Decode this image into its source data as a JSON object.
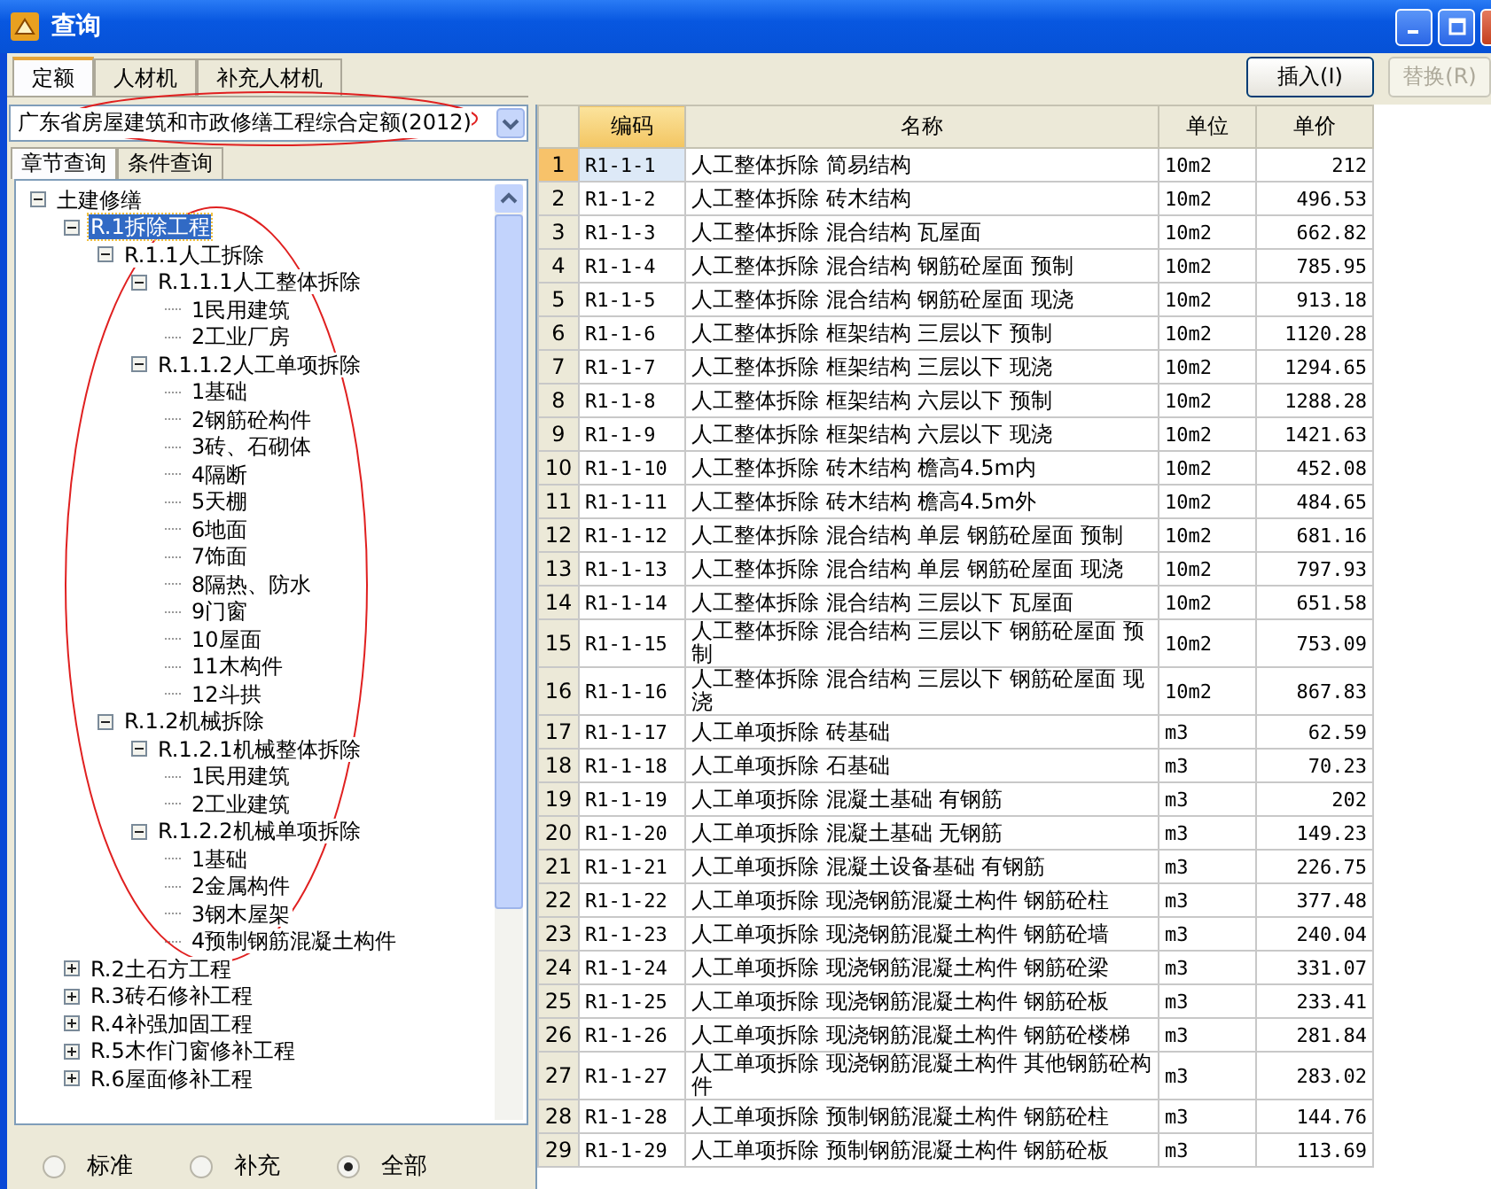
{
  "window": {
    "title": "查询"
  },
  "tabs": [
    {
      "label": "定额",
      "selected": true
    },
    {
      "label": "人材机",
      "selected": false
    },
    {
      "label": "补充人材机",
      "selected": false
    }
  ],
  "buttons": [
    {
      "label": "插入(I)",
      "disabled": false
    },
    {
      "label": "替换(R)",
      "disabled": true
    }
  ],
  "library": {
    "value": "广东省房屋建筑和市政修缮工程综合定额(2012)"
  },
  "query_tabs": [
    {
      "label": "章节查询",
      "selected": true
    },
    {
      "label": "条件查询",
      "selected": false
    }
  ],
  "tree": [
    {
      "label": "土建修缮",
      "expanded": true,
      "selected": false,
      "children": [
        {
          "label": "R.1拆除工程",
          "expanded": true,
          "selected": true,
          "children": [
            {
              "label": "R.1.1人工拆除",
              "expanded": true,
              "selected": false,
              "children": [
                {
                  "label": "R.1.1.1人工整体拆除",
                  "expanded": true,
                  "selected": false,
                  "children": [
                    {
                      "label": "1民用建筑",
                      "selected": false
                    },
                    {
                      "label": "2工业厂房",
                      "selected": false
                    }
                  ]
                },
                {
                  "label": "R.1.1.2人工单项拆除",
                  "expanded": true,
                  "selected": false,
                  "children": [
                    {
                      "label": "1基础",
                      "selected": false
                    },
                    {
                      "label": "2钢筋砼构件",
                      "selected": false
                    },
                    {
                      "label": "3砖、石砌体",
                      "selected": false
                    },
                    {
                      "label": "4隔断",
                      "selected": false
                    },
                    {
                      "label": "5天棚",
                      "selected": false
                    },
                    {
                      "label": "6地面",
                      "selected": false
                    },
                    {
                      "label": "7饰面",
                      "selected": false
                    },
                    {
                      "label": "8隔热、防水",
                      "selected": false
                    },
                    {
                      "label": "9门窗",
                      "selected": false
                    },
                    {
                      "label": "10屋面",
                      "selected": false
                    },
                    {
                      "label": "11木构件",
                      "selected": false
                    },
                    {
                      "label": "12斗拱",
                      "selected": false
                    }
                  ]
                }
              ]
            },
            {
              "label": "R.1.2机械拆除",
              "expanded": true,
              "selected": false,
              "children": [
                {
                  "label": "R.1.2.1机械整体拆除",
                  "expanded": true,
                  "selected": false,
                  "children": [
                    {
                      "label": "1民用建筑",
                      "selected": false
                    },
                    {
                      "label": "2工业建筑",
                      "selected": false
                    }
                  ]
                },
                {
                  "label": "R.1.2.2机械单项拆除",
                  "expanded": true,
                  "selected": false,
                  "children": [
                    {
                      "label": "1基础",
                      "selected": false
                    },
                    {
                      "label": "2金属构件",
                      "selected": false
                    },
                    {
                      "label": "3钢木屋架",
                      "selected": false
                    },
                    {
                      "label": "4预制钢筋混凝土构件",
                      "selected": false
                    }
                  ]
                }
              ]
            }
          ]
        },
        {
          "label": "R.2土石方工程",
          "expanded": false,
          "selected": false
        },
        {
          "label": "R.3砖石修补工程",
          "expanded": false,
          "selected": false
        },
        {
          "label": "R.4补强加固工程",
          "expanded": false,
          "selected": false
        },
        {
          "label": "R.5木作门窗修补工程",
          "expanded": false,
          "selected": false
        },
        {
          "label": "R.6屋面修补工程",
          "expanded": false,
          "selected": false
        }
      ]
    }
  ],
  "filter": [
    {
      "label": "标准",
      "selected": false
    },
    {
      "label": "补充",
      "selected": false
    },
    {
      "label": "全部",
      "selected": true
    }
  ],
  "table": {
    "columns": [
      "编码",
      "名称",
      "单位",
      "单价"
    ],
    "rows": [
      {
        "index": "1",
        "code": "R1-1-1",
        "name": "人工整体拆除 简易结构",
        "unit": "10m2",
        "price": "212",
        "selected": true
      },
      {
        "index": "2",
        "code": "R1-1-2",
        "name": "人工整体拆除 砖木结构",
        "unit": "10m2",
        "price": "496.53",
        "selected": false
      },
      {
        "index": "3",
        "code": "R1-1-3",
        "name": "人工整体拆除 混合结构 瓦屋面",
        "unit": "10m2",
        "price": "662.82",
        "selected": false
      },
      {
        "index": "4",
        "code": "R1-1-4",
        "name": "人工整体拆除 混合结构 钢筋砼屋面 预制",
        "unit": "10m2",
        "price": "785.95",
        "selected": false
      },
      {
        "index": "5",
        "code": "R1-1-5",
        "name": "人工整体拆除 混合结构 钢筋砼屋面 现浇",
        "unit": "10m2",
        "price": "913.18",
        "selected": false
      },
      {
        "index": "6",
        "code": "R1-1-6",
        "name": "人工整体拆除 框架结构 三层以下 预制",
        "unit": "10m2",
        "price": "1120.28",
        "selected": false
      },
      {
        "index": "7",
        "code": "R1-1-7",
        "name": "人工整体拆除 框架结构 三层以下 现浇",
        "unit": "10m2",
        "price": "1294.65",
        "selected": false
      },
      {
        "index": "8",
        "code": "R1-1-8",
        "name": "人工整体拆除 框架结构 六层以下 预制",
        "unit": "10m2",
        "price": "1288.28",
        "selected": false
      },
      {
        "index": "9",
        "code": "R1-1-9",
        "name": "人工整体拆除 框架结构 六层以下 现浇",
        "unit": "10m2",
        "price": "1421.63",
        "selected": false
      },
      {
        "index": "10",
        "code": "R1-1-10",
        "name": "人工整体拆除 砖木结构 檐高4.5m内",
        "unit": "10m2",
        "price": "452.08",
        "selected": false
      },
      {
        "index": "11",
        "code": "R1-1-11",
        "name": "人工整体拆除 砖木结构 檐高4.5m外",
        "unit": "10m2",
        "price": "484.65",
        "selected": false
      },
      {
        "index": "12",
        "code": "R1-1-12",
        "name": "人工整体拆除 混合结构 单层 钢筋砼屋面 预制",
        "unit": "10m2",
        "price": "681.16",
        "selected": false
      },
      {
        "index": "13",
        "code": "R1-1-13",
        "name": "人工整体拆除 混合结构 单层 钢筋砼屋面 现浇",
        "unit": "10m2",
        "price": "797.93",
        "selected": false
      },
      {
        "index": "14",
        "code": "R1-1-14",
        "name": "人工整体拆除 混合结构 三层以下 瓦屋面",
        "unit": "10m2",
        "price": "651.58",
        "selected": false
      },
      {
        "index": "15",
        "code": "R1-1-15",
        "name": "人工整体拆除 混合结构 三层以下 钢筋砼屋面 预制",
        "unit": "10m2",
        "price": "753.09",
        "selected": false
      },
      {
        "index": "16",
        "code": "R1-1-16",
        "name": "人工整体拆除 混合结构 三层以下 钢筋砼屋面 现浇",
        "unit": "10m2",
        "price": "867.83",
        "selected": false
      },
      {
        "index": "17",
        "code": "R1-1-17",
        "name": "人工单项拆除 砖基础",
        "unit": "m3",
        "price": "62.59",
        "selected": false
      },
      {
        "index": "18",
        "code": "R1-1-18",
        "name": "人工单项拆除 石基础",
        "unit": "m3",
        "price": "70.23",
        "selected": false
      },
      {
        "index": "19",
        "code": "R1-1-19",
        "name": "人工单项拆除 混凝土基础 有钢筋",
        "unit": "m3",
        "price": "202",
        "selected": false
      },
      {
        "index": "20",
        "code": "R1-1-20",
        "name": "人工单项拆除 混凝土基础 无钢筋",
        "unit": "m3",
        "price": "149.23",
        "selected": false
      },
      {
        "index": "21",
        "code": "R1-1-21",
        "name": "人工单项拆除 混凝土设备基础 有钢筋",
        "unit": "m3",
        "price": "226.75",
        "selected": false
      },
      {
        "index": "22",
        "code": "R1-1-22",
        "name": "人工单项拆除 现浇钢筋混凝土构件 钢筋砼柱",
        "unit": "m3",
        "price": "377.48",
        "selected": false
      },
      {
        "index": "23",
        "code": "R1-1-23",
        "name": "人工单项拆除 现浇钢筋混凝土构件 钢筋砼墙",
        "unit": "m3",
        "price": "240.04",
        "selected": false
      },
      {
        "index": "24",
        "code": "R1-1-24",
        "name": "人工单项拆除 现浇钢筋混凝土构件 钢筋砼梁",
        "unit": "m3",
        "price": "331.07",
        "selected": false
      },
      {
        "index": "25",
        "code": "R1-1-25",
        "name": "人工单项拆除 现浇钢筋混凝土构件 钢筋砼板",
        "unit": "m3",
        "price": "233.41",
        "selected": false
      },
      {
        "index": "26",
        "code": "R1-1-26",
        "name": "人工单项拆除 现浇钢筋混凝土构件 钢筋砼楼梯",
        "unit": "m3",
        "price": "281.84",
        "selected": false
      },
      {
        "index": "27",
        "code": "R1-1-27",
        "name": "人工单项拆除 现浇钢筋混凝土构件 其他钢筋砼构件",
        "unit": "m3",
        "price": "283.02",
        "selected": false
      },
      {
        "index": "28",
        "code": "R1-1-28",
        "name": "人工单项拆除 预制钢筋混凝土构件 钢筋砼柱",
        "unit": "m3",
        "price": "144.76",
        "selected": false
      },
      {
        "index": "29",
        "code": "R1-1-29",
        "name": "人工单项拆除 预制钢筋混凝土构件 钢筋砼板",
        "unit": "m3",
        "price": "113.69",
        "selected": false
      }
    ]
  }
}
